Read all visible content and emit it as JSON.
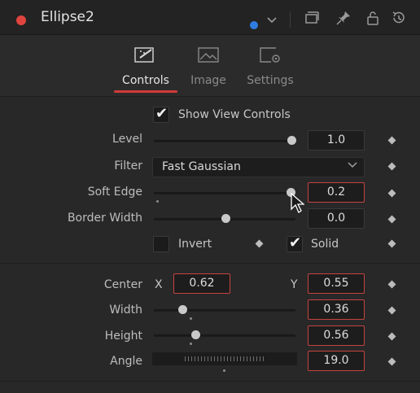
{
  "window": {
    "title": "Ellipse2",
    "title_dot_color": "#e0443f",
    "color_indicator": "#2f7de0"
  },
  "tabs": [
    {
      "label": "Controls",
      "icon": "controls-icon",
      "active": true
    },
    {
      "label": "Image",
      "icon": "image-icon",
      "active": false
    },
    {
      "label": "Settings",
      "icon": "settings-icon",
      "active": false
    }
  ],
  "controls": {
    "show_view_controls": {
      "label": "Show View Controls",
      "checked": true
    },
    "level": {
      "label": "Level",
      "value": "1.0",
      "fraction": 1.0
    },
    "filter": {
      "label": "Filter",
      "value": "Fast Gaussian"
    },
    "soft_edge": {
      "label": "Soft Edge",
      "value": "0.2",
      "fraction": 0.98
    },
    "border_width": {
      "label": "Border Width",
      "value": "0.0",
      "fraction": 0.5
    },
    "invert": {
      "label": "Invert",
      "checked": false
    },
    "solid": {
      "label": "Solid",
      "checked": true
    },
    "center": {
      "label": "Center",
      "x_label": "X",
      "x_value": "0.62",
      "y_label": "Y",
      "y_value": "0.55"
    },
    "width": {
      "label": "Width",
      "value": "0.36",
      "fraction": 0.2
    },
    "height": {
      "label": "Height",
      "value": "0.56",
      "fraction": 0.29
    },
    "angle": {
      "label": "Angle",
      "value": "19.0"
    }
  }
}
